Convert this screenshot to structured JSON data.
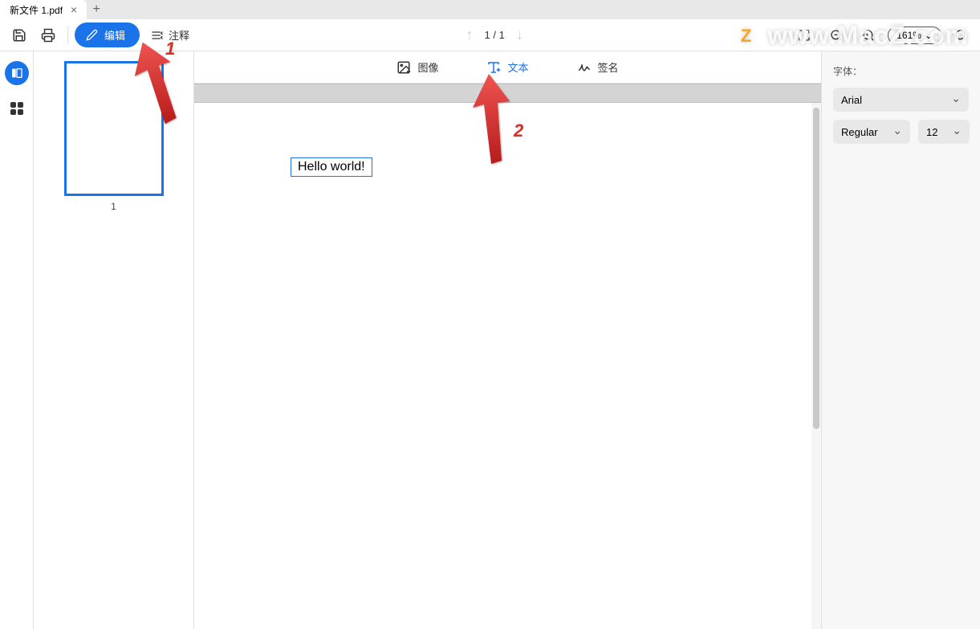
{
  "tab": {
    "title": "新文件 1.pdf"
  },
  "toolbar": {
    "edit_label": "编辑",
    "annotate_label": "注释"
  },
  "page_nav": {
    "current": "1",
    "total": "1",
    "sep": "/"
  },
  "zoom": {
    "level": "161%"
  },
  "sub_toolbar": {
    "image_label": "图像",
    "text_label": "文本",
    "signature_label": "签名"
  },
  "thumbnails": {
    "page1_num": "1"
  },
  "document": {
    "text_content": "Hello world!"
  },
  "right_panel": {
    "font_label": "字体：",
    "font_family": "Arial",
    "font_weight": "Regular",
    "font_size": "12"
  },
  "watermark": {
    "logo": "Z",
    "text": "www.MacZ.com"
  },
  "annotations": {
    "one": "1",
    "two": "2"
  }
}
